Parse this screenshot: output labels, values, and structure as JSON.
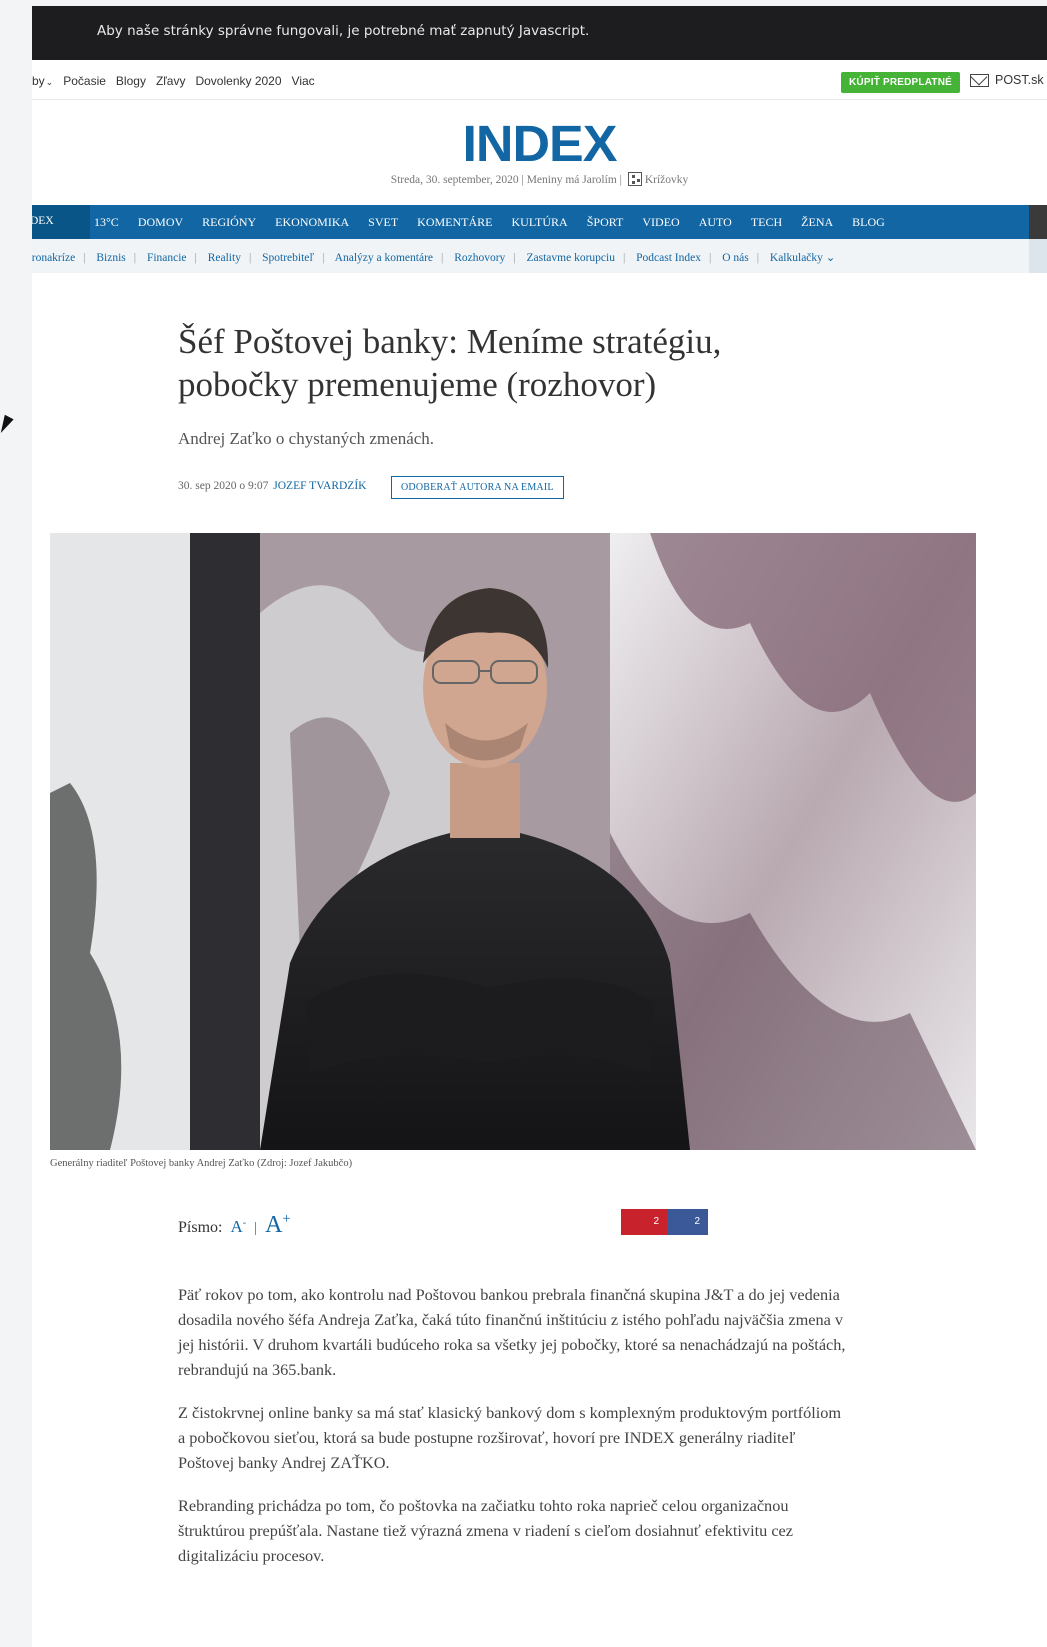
{
  "js_warning": "Aby naše stránky správne fungovali, je potrebné mať zapnutý Javascript.",
  "util_nav": {
    "links": [
      "-by",
      "Počasie",
      "Blogy",
      "Zľavy",
      "Dovolenky 2020",
      "Viac"
    ],
    "buy_label": "KÚPIŤ PREDPLATNÉ",
    "post_label": "POST.sk"
  },
  "masthead": {
    "logo": "INDEX",
    "dateline": "Streda, 30. september, 2020 | Meniny má Jarolím |",
    "crossword": "Krížovky"
  },
  "main_nav": {
    "brand": "DEX",
    "temperature": "13°C",
    "items": [
      "DOMOV",
      "REGIÓNY",
      "EKONOMIKA",
      "SVET",
      "KOMENTÁRE",
      "KULTÚRA",
      "ŠPORT",
      "VIDEO",
      "AUTO",
      "TECH",
      "ŽENA",
      "BLOG"
    ]
  },
  "sub_nav": {
    "items": [
      "oronakríze",
      "Biznis",
      "Financie",
      "Reality",
      "Spotrebiteľ",
      "Analýzy a komentáre",
      "Rozhovory",
      "Zastavme korupciu",
      "Podcast Index",
      "O nás"
    ],
    "more": "Kalkulačky"
  },
  "article": {
    "headline_line1": "Šéf Poštovej banky: Meníme stratégiu,",
    "headline_line2": "pobočky premenujeme (rozhovor)",
    "perex": "Andrej Zaťko o chystaných zmenách.",
    "date": "30. sep 2020 o 9:07",
    "author": "Jozef Tvardzík",
    "subscribe": "ODOBERAŤ AUTORA NA EMAIL",
    "photo_caption": "Generálny riaditeľ Poštovej banky Andrej Zaťko (Zdroj: Jozef Jakubčo)",
    "font_label": "Písmo:",
    "font_smaller": "A",
    "font_smaller_sup": "-",
    "font_larger": "A",
    "font_larger_sup": "+",
    "share_counts": [
      "2",
      "2"
    ],
    "paragraphs": [
      "Päť rokov po tom, ako kontrolu nad Poštovou bankou prebrala finančná skupina J&T a do jej vedenia dosadila nového šéfa Andreja Zaťka, čaká túto finančnú inštitúciu z istého pohľadu najväčšia zmena v jej histórii. V druhom kvartáli budúceho roka sa všetky jej pobočky, ktoré sa nenachádzajú na poštách, rebrandujú na 365.bank.",
      "Z čistokrvnej online banky sa má stať klasický bankový dom s komplexným produktovým portfóliom a pobočkovou sieťou, ktorá sa bude postupne rozširovať, hovorí pre INDEX generálny riaditeľ Poštovej banky Andrej ZAŤKO.",
      "Rebranding prichádza po tom, čo poštovka na začiatku tohto roka naprieč celou organizačnou štruktúrou prepúšťala. Nastane tiež výrazná zmena v riadení s cieľom dosiahnuť efektivitu cez digitalizáciu procesov."
    ]
  },
  "colors": {
    "brand_blue": "#1166a3",
    "buy_green": "#45b336",
    "share_red": "#c8232c",
    "share_blue": "#3b5998"
  }
}
